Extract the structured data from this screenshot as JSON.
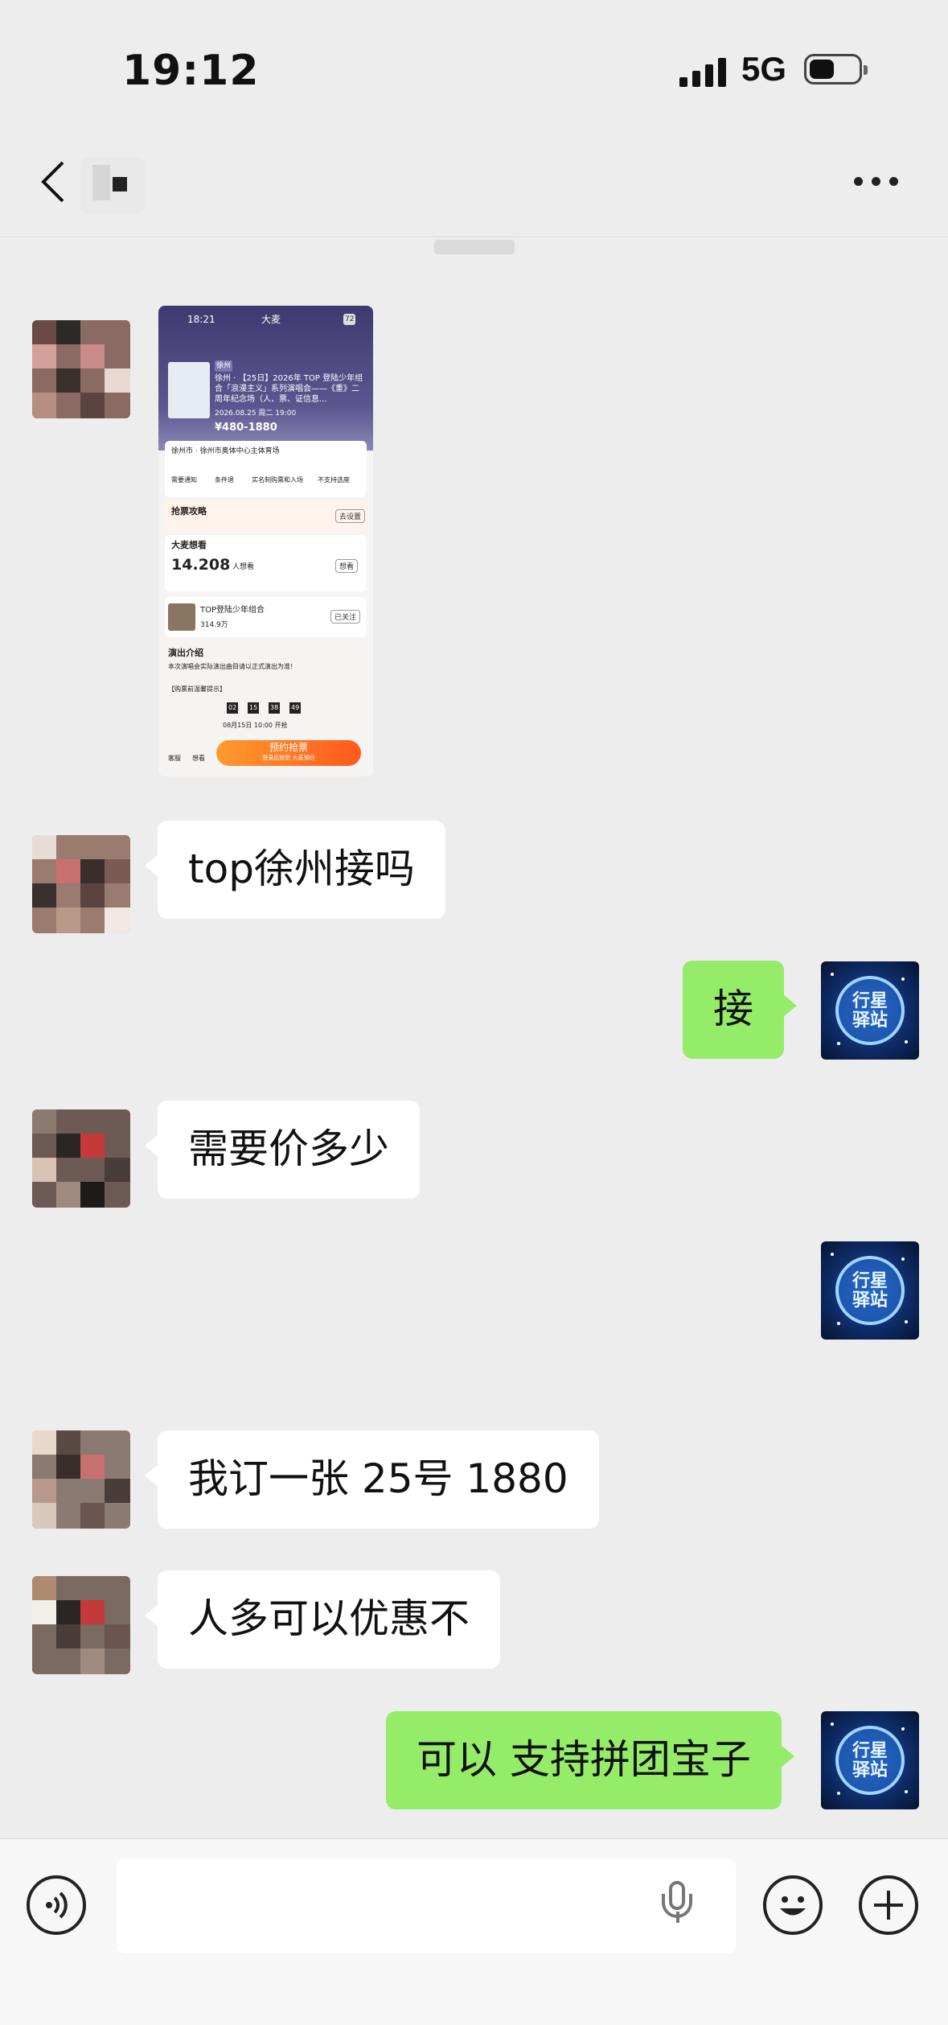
{
  "status_bar": {
    "time": "19:12",
    "network": "5G"
  },
  "nav": {
    "title": "",
    "more_icon": "more-dots-icon"
  },
  "thumbnail": {
    "time": "18:21",
    "brand": "大麦",
    "battery": "72",
    "tags": "徐州",
    "title": "徐州 · 【25日】2026年 TOP 登陆少年组合「浪漫主义」系列演唱会——《重》二周年纪念场（人、票、证信息...",
    "date": "2026.08.25 周二 19:00",
    "price": "¥480-1880",
    "venue": "徐州市 · 徐州市奥体中心主体育场",
    "features": [
      "需要通知",
      "条件退",
      "实名制购票和入场",
      "不支持选座"
    ],
    "strategy": "抢票攻略",
    "strategy_btn": "去设置",
    "want_title": "大麦想看",
    "want_count": "14.208",
    "want_unit": "人想看",
    "want_btn": "想看",
    "artist": "TOP登陆少年组合",
    "artist_fans": "314.9万",
    "artist_btn": "已关注",
    "intro_title": "演出介绍",
    "intro_text": "本次演唱会实际演出曲目请以正式演出为准!",
    "notice": "【购票前温馨提示】",
    "countdown": [
      "02",
      "15",
      "38",
      "49"
    ],
    "sale_time": "08月15日 10:00 开抢",
    "footer_left": "客服",
    "footer_mid": "想看",
    "buy_btn": "预约抢票",
    "buy_sub": "登录后抢票 大麦预约"
  },
  "messages": [
    {
      "side": "in",
      "text": "top徐州接吗"
    },
    {
      "side": "out",
      "text": "接"
    },
    {
      "side": "in",
      "text": "需要价多少"
    },
    {
      "side": "out",
      "text": ""
    },
    {
      "side": "in",
      "text": "我订一张 25号 1880"
    },
    {
      "side": "in",
      "text": "人多可以优惠不"
    },
    {
      "side": "out",
      "text": "可以  支持拼团宝子"
    }
  ],
  "my_avatar_badge": "行星 驿站",
  "input_bar": {
    "voice_icon": "voice-mode-icon",
    "mic_icon": "microphone-icon",
    "emoji_icon": "emoji-icon",
    "plus_icon": "plus-icon"
  },
  "colors": {
    "bg": "#ededed",
    "out_bubble": "#95ec69",
    "in_bubble": "#ffffff"
  }
}
